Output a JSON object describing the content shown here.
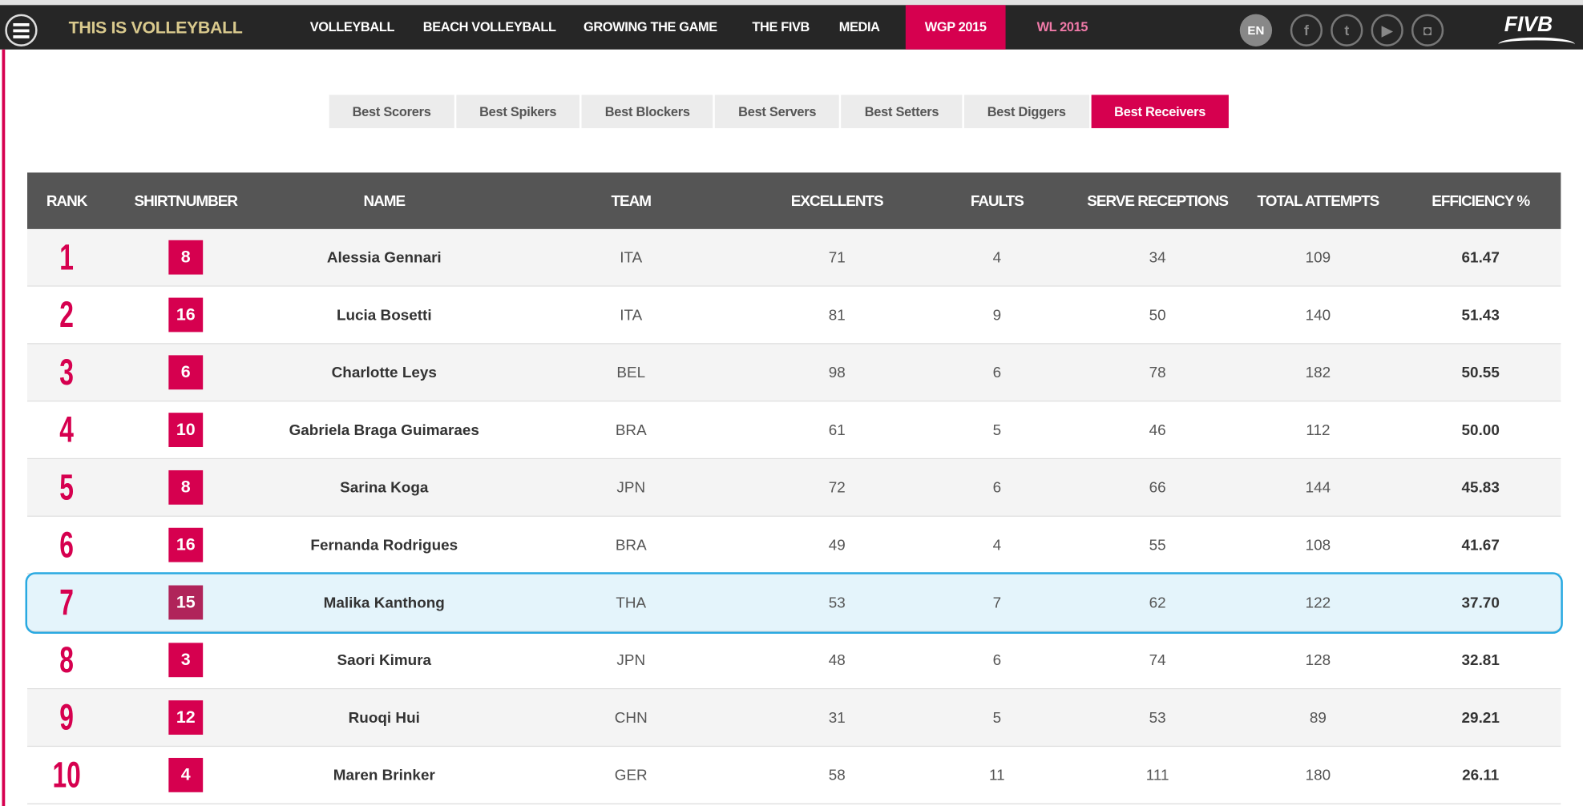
{
  "nav": {
    "brand": "THIS IS VOLLEYBALL",
    "items": [
      "VOLLEYBALL",
      "BEACH VOLLEYBALL",
      "GROWING THE GAME",
      "THE FIVB",
      "MEDIA",
      "WGP 2015",
      "WL 2015"
    ],
    "lang": "EN",
    "social": [
      "facebook-icon",
      "twitter-icon",
      "youtube-icon",
      "instagram-icon"
    ],
    "logo": "FIVB"
  },
  "tabs": [
    "Best Scorers",
    "Best Spikers",
    "Best Blockers",
    "Best Servers",
    "Best Setters",
    "Best Diggers",
    "Best Receivers"
  ],
  "active_tab": "Best Receivers",
  "colors": {
    "accent": "#d6004f",
    "nav_bg": "#262626",
    "header_bg": "#555555",
    "highlight": "#29a9e1"
  },
  "table": {
    "columns": [
      "RANK",
      "SHIRTNUMBER",
      "NAME",
      "TEAM",
      "EXCELLENTS",
      "FAULTS",
      "SERVE RECEPTIONS",
      "TOTAL ATTEMPTS",
      "EFFICIENCY %"
    ],
    "rows": [
      [
        "1",
        "8",
        "Alessia Gennari",
        "ITA",
        "71",
        "4",
        "34",
        "109",
        "61.47"
      ],
      [
        "2",
        "16",
        "Lucia Bosetti",
        "ITA",
        "81",
        "9",
        "50",
        "140",
        "51.43"
      ],
      [
        "3",
        "6",
        "Charlotte Leys",
        "BEL",
        "98",
        "6",
        "78",
        "182",
        "50.55"
      ],
      [
        "4",
        "10",
        "Gabriela Braga Guimaraes",
        "BRA",
        "61",
        "5",
        "46",
        "112",
        "50.00"
      ],
      [
        "5",
        "8",
        "Sarina Koga",
        "JPN",
        "72",
        "6",
        "66",
        "144",
        "45.83"
      ],
      [
        "6",
        "16",
        "Fernanda Rodrigues",
        "BRA",
        "49",
        "4",
        "55",
        "108",
        "41.67"
      ],
      [
        "7",
        "15",
        "Malika Kanthong",
        "THA",
        "53",
        "7",
        "62",
        "122",
        "37.70"
      ],
      [
        "8",
        "3",
        "Saori Kimura",
        "JPN",
        "48",
        "6",
        "74",
        "128",
        "32.81"
      ],
      [
        "9",
        "12",
        "Ruoqi Hui",
        "CHN",
        "31",
        "5",
        "53",
        "89",
        "29.21"
      ],
      [
        "10",
        "4",
        "Maren Brinker",
        "GER",
        "58",
        "11",
        "111",
        "180",
        "26.11"
      ]
    ]
  }
}
